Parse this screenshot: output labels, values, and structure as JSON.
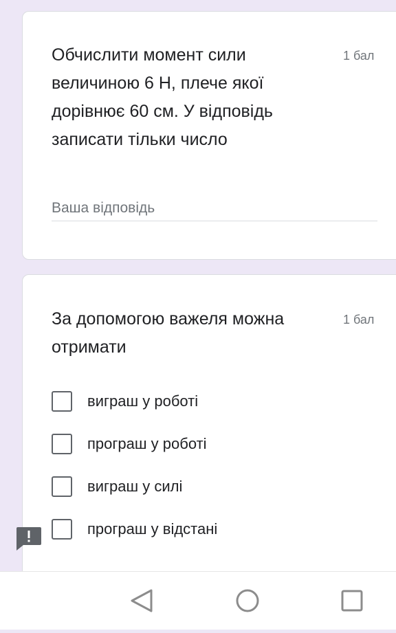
{
  "question1": {
    "title_lines": [
      "Обчислити момент сили",
      "величиною 6 Н, плече якої",
      "дорівнює 60 см. У відповідь",
      "записати тільки число"
    ],
    "points": "1 бал",
    "answer_placeholder": "Ваша відповідь",
    "answer_value": ""
  },
  "question2": {
    "title_lines": [
      "За допомогою важеля можна",
      "отримати"
    ],
    "points": "1 бал",
    "options": [
      {
        "label": "виграш у роботі",
        "checked": false
      },
      {
        "label": "програш у роботі",
        "checked": false
      },
      {
        "label": "виграш у силі",
        "checked": false
      },
      {
        "label": "програш у відстані",
        "checked": false
      }
    ]
  },
  "feedback_icon": "report-problem-icon",
  "navbar": {
    "icons": [
      "back-triangle-icon",
      "home-circle-icon",
      "recents-square-icon"
    ]
  },
  "colors": {
    "page_background": "#ede7f6",
    "card_background": "#ffffff",
    "text": "#202124",
    "secondary_text": "#70757a",
    "checkbox_border": "#5f6368"
  }
}
